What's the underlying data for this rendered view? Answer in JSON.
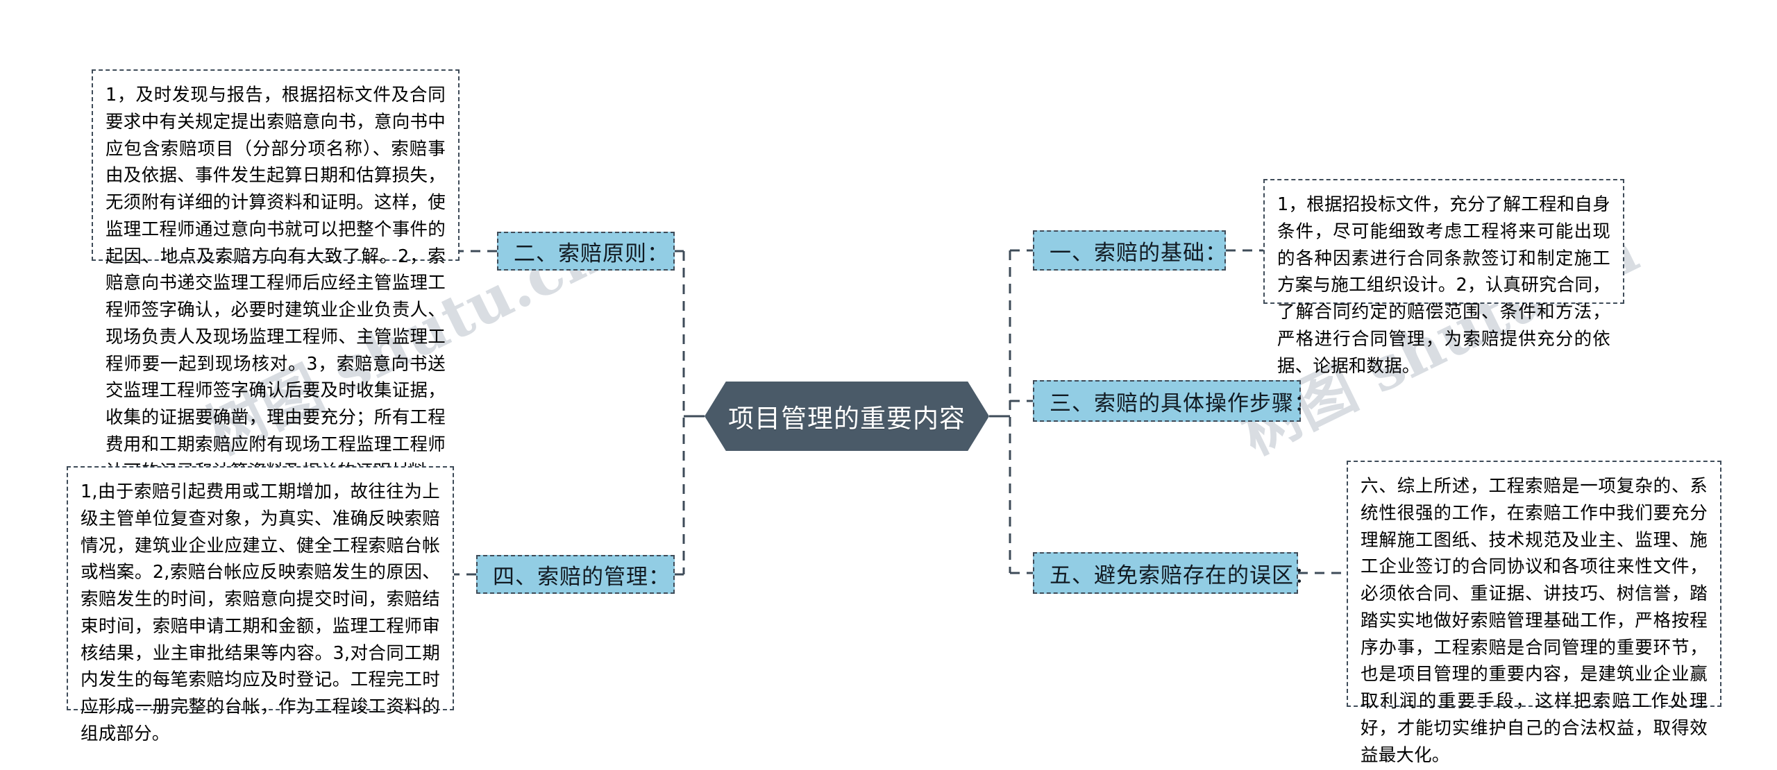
{
  "diagram": {
    "type": "mind-map",
    "root": {
      "label": "项目管理的重要内容",
      "shape": "hexagon",
      "fill_color": "#4a5a68",
      "text_color": "#ffffff"
    },
    "topic_fill_color": "#92cde4",
    "border_color": "#3e4b58",
    "branches": [
      {
        "id": "basis",
        "side": "right",
        "topic": "一、索赔的基础：",
        "detail": "1，根据招投标文件，充分了解工程和自身条件，尽可能细致考虑工程将来可能出现的各种因素进行合同条款签订和制定施工方案与施工组织设计。2，认真研究合同，了解合同约定的赔偿范围、条件和方法，严格进行合同管理，为索赔提供充分的依据、论据和数据。"
      },
      {
        "id": "principles",
        "side": "left",
        "topic": "二、索赔原则：",
        "detail": "1，及时发现与报告，根据招标文件及合同要求中有关规定提出索赔意向书，意向书中应包含索赔项目（分部分项名称）、索赔事由及依据、事件发生起算日期和估算损失，无须附有详细的计算资料和证明。这样，使监理工程师通过意向书就可以把整个事件的起因、地点及索赔方向有大致了解。2，索赔意向书递交监理工程师后应经主管监理工程师签字确认，必要时建筑业企业负责人、现场负责人及现场监理工程师、主管监理工程师要一起到现场核对。3，索赔意向书送交监理工程师签字确认后要及时收集证据，收集的证据要确凿，理由要充分；所有工程费用和工期索赔应附有现场工程监理工程师认可的记录和计算资料及相关的证明材料。"
      },
      {
        "id": "steps",
        "side": "right",
        "topic": "三、索赔的具体操作步骤："
      },
      {
        "id": "management",
        "side": "left",
        "topic": "四、索赔的管理：",
        "detail": "1,由于索赔引起费用或工期增加，故往往为上级主管单位复查对象，为真实、准确反映索赔情况，建筑业企业应建立、健全工程索赔台帐或档案。2,索赔台帐应反映索赔发生的原因、索赔发生的时间，索赔意向提交时间，索赔结束时间，索赔申请工期和金额，监理工程师审核结果，业主审批结果等内容。3,对合同工期内发生的每笔索赔均应及时登记。工程完工时应形成一册完整的台帐，作为工程竣工资料的组成部分。"
      },
      {
        "id": "avoid",
        "side": "right",
        "topic": "五、避免索赔存在的误区：",
        "detail": "六、综上所述，工程索赔是一项复杂的、系统性很强的工作，在索赔工作中我们要充分理解施工图纸、技术规范及业主、监理、施工企业签订的合同协议和各项往来性文件，必须依合同、重证据、讲技巧、树信誉，踏踏实实地做好索赔管理基础工作，严格按程序办事，工程索赔是合同管理的重要环节，也是项目管理的重要内容，是建筑业企业赢取利润的重要手段，这样把索赔工作处理好，才能切实维护自己的合法权益，取得效益最大化。"
      }
    ],
    "watermarks": [
      {
        "text": "树图 shutu.cn",
        "position": "left"
      },
      {
        "text": "树图 shutu.cn",
        "position": "right"
      }
    ]
  }
}
